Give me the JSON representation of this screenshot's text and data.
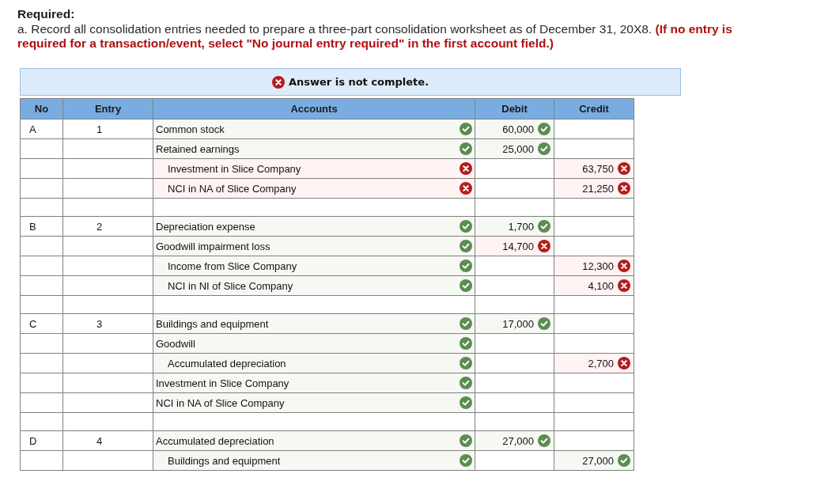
{
  "instructions": {
    "heading": "Required:",
    "text": "a. Record all consolidation entries needed to prepare a three-part consolidation worksheet as of December 31, 20X8. **(If no entry is required for a transaction/event, select \"No journal entry required\" in the first account field.)**"
  },
  "feedback": {
    "complete": false,
    "message": "Answer is not complete."
  },
  "table": {
    "columns": [
      "No",
      "Entry",
      "Accounts",
      "Debit",
      "Credit"
    ],
    "entries": [
      {
        "no": "A",
        "entry": "1",
        "lines": [
          {
            "account": "Common stock",
            "indented": false,
            "account_correct": true,
            "debit": "60,000",
            "debit_correct": true
          },
          {
            "account": "Retained earnings",
            "indented": false,
            "account_correct": true,
            "debit": "25,000",
            "debit_correct": true
          },
          {
            "account": "Investment in Slice Company",
            "indented": true,
            "account_correct": false,
            "credit": "63,750",
            "credit_correct": false
          },
          {
            "account": "NCI in NA of Slice Company",
            "indented": true,
            "account_correct": false,
            "credit": "21,250",
            "credit_correct": false
          }
        ]
      },
      {
        "no": "B",
        "entry": "2",
        "lines": [
          {
            "account": "Depreciation expense",
            "indented": false,
            "account_correct": true,
            "debit": "1,700",
            "debit_correct": true
          },
          {
            "account": "Goodwill impairment loss",
            "indented": false,
            "account_correct": true,
            "debit": "14,700",
            "debit_correct": false
          },
          {
            "account": "Income from Slice Company",
            "indented": true,
            "account_correct": true,
            "credit": "12,300",
            "credit_correct": false
          },
          {
            "account": "NCI in NI of Slice Company",
            "indented": true,
            "account_correct": true,
            "credit": "4,100",
            "credit_correct": false
          }
        ]
      },
      {
        "no": "C",
        "entry": "3",
        "lines": [
          {
            "account": "Buildings and equipment",
            "indented": false,
            "account_correct": true,
            "debit": "17,000",
            "debit_correct": true
          },
          {
            "account": "Goodwill",
            "indented": false,
            "account_correct": true
          },
          {
            "account": "Accumulated depreciation",
            "indented": true,
            "account_correct": true,
            "credit": "2,700",
            "credit_correct": false
          },
          {
            "account": "Investment in Slice Company",
            "indented": false,
            "account_correct": true
          },
          {
            "account": "NCI in NA of Slice Company",
            "indented": false,
            "account_correct": true
          }
        ]
      },
      {
        "no": "D",
        "entry": "4",
        "lines": [
          {
            "account": "Accumulated depreciation",
            "indented": false,
            "account_correct": true,
            "debit": "27,000",
            "debit_correct": true
          },
          {
            "account": "Buildings and equipment",
            "indented": true,
            "account_correct": true,
            "credit": "27,000",
            "credit_correct": true
          }
        ]
      }
    ]
  }
}
